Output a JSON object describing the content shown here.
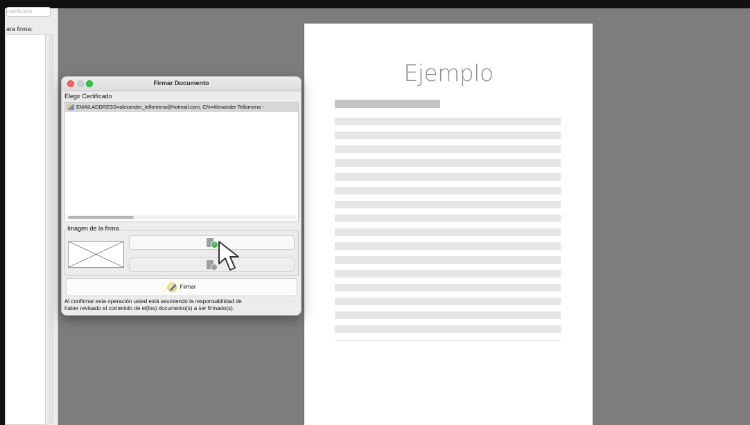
{
  "left_panel": {
    "field_text": "certificado",
    "label": "ara firma:"
  },
  "document": {
    "title": "Ejemplo"
  },
  "dialog": {
    "title": "Firmar Documento",
    "choose_certificate_label": "Elegir Certificado",
    "certificates": [
      {
        "text": "EMAILADDRESS=alexander_tellomena@hotmail.com, CN=Alexander Tellomena -",
        "icon": "certificate-icon"
      }
    ],
    "signature_image_legend": "Imagen de la firma",
    "sign_button_label": "Firmar",
    "disclaimer_line1": "Al confirmar esta operación usted está asumiendo la responsabilidad de",
    "disclaimer_line2": "haber revisado el contenido de el(los) documento(s) a ser firmado(s)."
  },
  "colors": {
    "workspace_bg": "#7d7d7d",
    "dialog_bg": "#ececec",
    "selected_row": "#d7d7d7",
    "check_green": "#3bb54a"
  }
}
